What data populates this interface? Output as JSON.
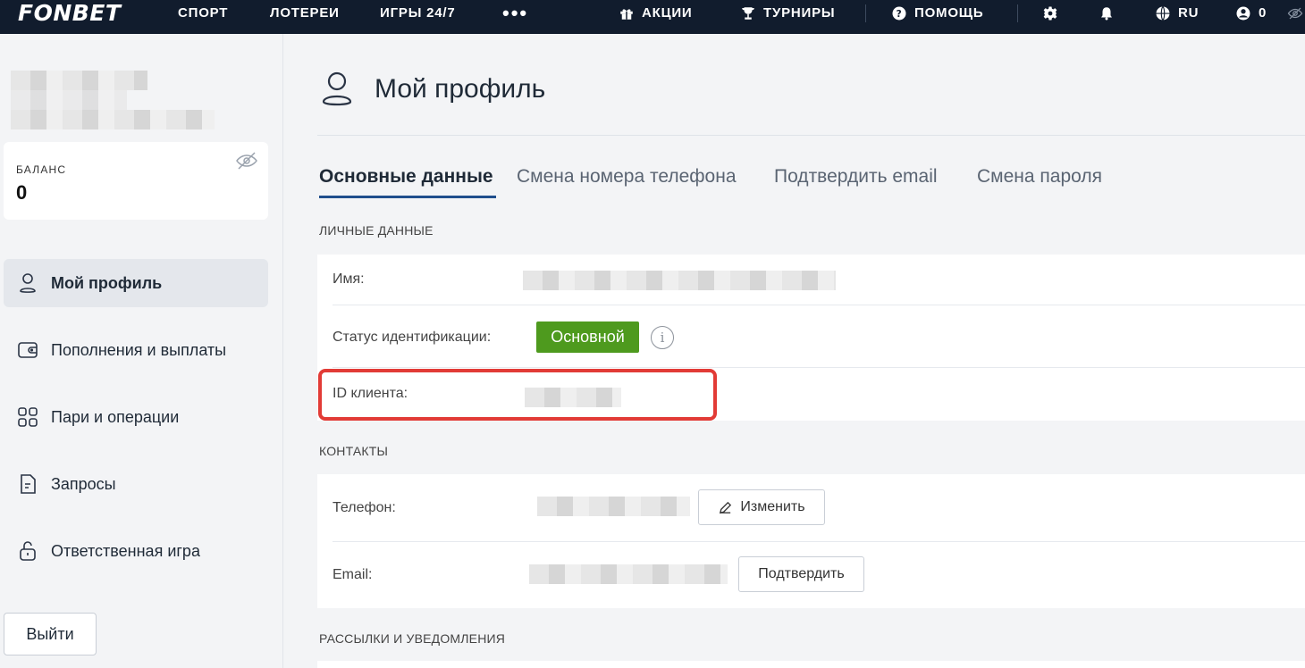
{
  "topnav": {
    "logo": "FONBET",
    "items": [
      "СПОРТ",
      "ЛОТЕРЕИ",
      "ИГРЫ 24/7"
    ],
    "more": "•••",
    "promos": "АКЦИИ",
    "tournaments": "ТУРНИРЫ",
    "help": "ПОМОЩЬ",
    "language": "RU",
    "account_balance": "0"
  },
  "sidebar": {
    "balance_label": "БАЛАНС",
    "balance_value": "0",
    "menu": [
      {
        "label": "Мой профиль",
        "icon": "user-icon",
        "active": true
      },
      {
        "label": "Пополнения и выплаты",
        "icon": "wallet-icon"
      },
      {
        "label": "Пари и операции",
        "icon": "grid-icon"
      },
      {
        "label": "Запросы",
        "icon": "document-icon"
      },
      {
        "label": "Ответственная игра",
        "icon": "lock-icon"
      }
    ],
    "logout_label": "Выйти"
  },
  "main": {
    "title": "Мой профиль",
    "tabs": [
      "Основные данные",
      "Смена номера телефона",
      "Подтвердить email",
      "Смена пароля"
    ],
    "personal": {
      "section": "ЛИЧНЫЕ ДАННЫЕ",
      "name_label": "Имя:",
      "status_label": "Статус идентификации:",
      "status_value": "Основной",
      "client_id_label": "ID клиента:"
    },
    "contacts": {
      "section": "КОНТАКТЫ",
      "phone_label": "Телефон:",
      "change_label": "Изменить",
      "email_label": "Email:",
      "confirm_label": "Подтвердить"
    },
    "notifications_section": "РАССЫЛКИ И УВЕДОМЛЕНИЯ"
  },
  "colors": {
    "topbar": "#111c2d",
    "status_badge": "#4e9a1e",
    "highlight": "#e23b36",
    "tab_underline": "#1f4e8c"
  }
}
